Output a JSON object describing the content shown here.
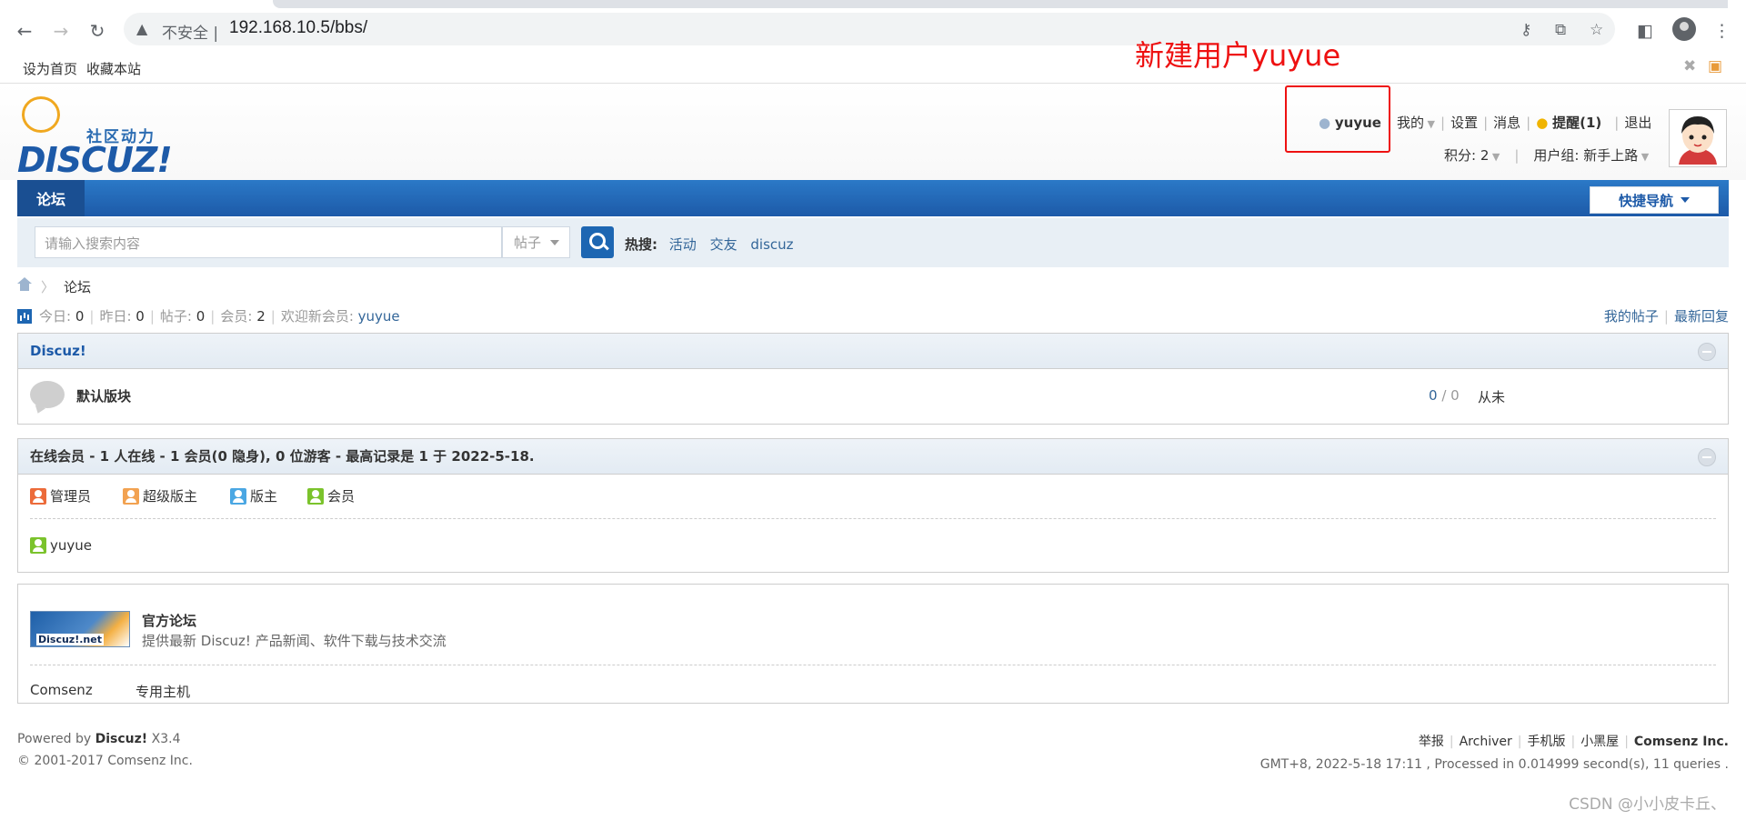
{
  "browser": {
    "insecure_label": "不安全",
    "url": "192.168.10.5/bbs/",
    "bookmarks": [
      "设为首页",
      "收藏本站"
    ]
  },
  "annotation": {
    "text": "新建用户yuyue"
  },
  "site": {
    "slogan": "社区动力",
    "wordmark": "DISCUZ!"
  },
  "user_menu": {
    "username": "yuyue",
    "mine": "我的",
    "settings": "设置",
    "messages": "消息",
    "reminders": "提醒(1)",
    "logout": "退出",
    "credits": "积分: 2",
    "usergroup": "用户组: 新手上路"
  },
  "nav": {
    "forum": "论坛",
    "quick_nav": "快捷导航"
  },
  "search": {
    "placeholder": "请输入搜索内容",
    "type": "帖子",
    "hot_label": "热搜:",
    "hot_terms": [
      "活动",
      "交友",
      "discuz"
    ]
  },
  "breadcrumb": {
    "current": "论坛"
  },
  "stats": {
    "today_label": "今日:",
    "today": "0",
    "yesterday_label": "昨日:",
    "yesterday": "0",
    "posts_label": "帖子:",
    "posts": "0",
    "members_label": "会员:",
    "members": "2",
    "welcome_label": "欢迎新会员:",
    "newest_member": "yuyue",
    "my_posts": "我的帖子",
    "latest_replies": "最新回复"
  },
  "category": {
    "title": "Discuz!",
    "forum": {
      "name": "默认版块",
      "threads": "0",
      "posts": "0",
      "last_post": "从未"
    }
  },
  "online": {
    "title": "在线会员 - 1 人在线 - 1 会员(0 隐身), 0 位游客 - 最高记录是 1 于 2022-5-18.",
    "legend": [
      {
        "label": "管理员",
        "color": "#ec6b3a"
      },
      {
        "label": "超级版主",
        "color": "#f2a251"
      },
      {
        "label": "版主",
        "color": "#4aa7e3"
      },
      {
        "label": "会员",
        "color": "#7bc32c"
      }
    ],
    "users": [
      "yuyue"
    ]
  },
  "links": {
    "logo_text": "Discuz!.net",
    "title": "官方论坛",
    "desc": "提供最新 Discuz! 产品新闻、软件下载与技术交流",
    "text_links": [
      "Comsenz",
      "专用主机"
    ]
  },
  "footer": {
    "powered_by": "Powered by",
    "product": "Discuz!",
    "version": "X3.4",
    "copyright": "© 2001-2017 Comsenz Inc.",
    "right_links": [
      "举报",
      "Archiver",
      "手机版",
      "小黑屋"
    ],
    "company": "Comsenz Inc.",
    "debug": "GMT+8, 2022-5-18 17:11 , Processed in 0.014999 second(s), 11 queries ."
  },
  "watermark": "CSDN @小小皮卡丘、"
}
